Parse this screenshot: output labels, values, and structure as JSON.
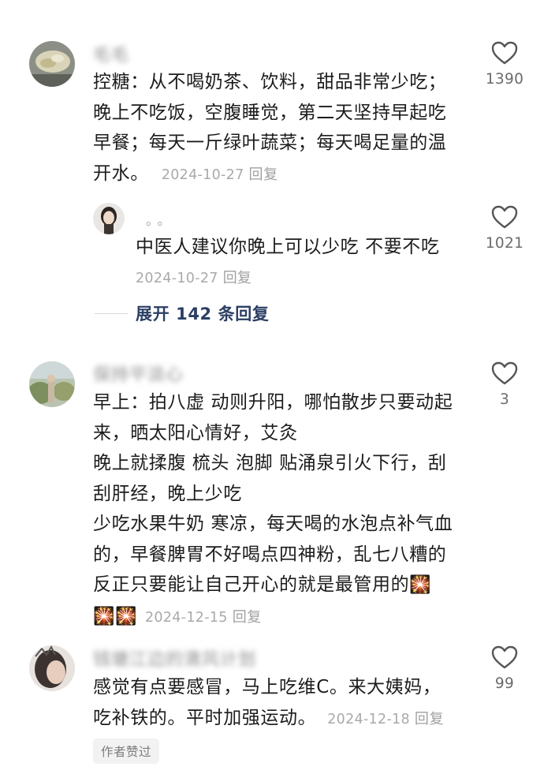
{
  "comments": [
    {
      "username": "毛毛",
      "lines": [
        "控糖：从不喝奶茶、饮料，甜品非常少吃；",
        "晚上不吃饭，空腹睡觉，第二天坚持早起吃",
        "早餐；每天一斤绿叶蔬菜；每天喝足量的温"
      ],
      "last_line": "开水。",
      "date": "2024-10-27",
      "reply": "回复",
      "likes": "1390"
    },
    {
      "username": "。。",
      "lines": [
        "中医人建议你晚上可以少吃 不要不吃"
      ],
      "date": "2024-10-27",
      "reply": "回复",
      "likes": "1021"
    },
    {
      "username": "保持平淡心",
      "lines": [
        "早上：拍八虚 动则升阳，哪怕散步只要动起",
        "来，晒太阳心情好，艾灸",
        "晚上就揉腹 梳头 泡脚 贴涌泉引火下行，刮",
        "刮肝经，晚上少吃",
        "少吃水果牛奶 寒凉，每天喝的水泡点补气血",
        "的，早餐脾胃不好喝点四神粉，乱七八糟的",
        "反正只要能让自己开心的就是最管用的"
      ],
      "emoji": "🎇🎇",
      "date": "2024-12-15",
      "reply": "回复",
      "likes": "3"
    },
    {
      "username": "钱塘江边的清风计划",
      "lines": [
        "感觉有点要感冒，马上吃维C。来大姨妈，"
      ],
      "last_line": "吃补铁的。平时加强运动。",
      "date": "2024-12-18",
      "reply": "回复",
      "likes": "99",
      "badge": "作者赞过"
    }
  ],
  "expand_replies": "展开 142 条回复",
  "colors": {
    "link_blue": "#2b3e63",
    "meta_gray": "#a9a9a9",
    "count_gray": "#6b6b6b"
  },
  "icons": {
    "like": "heart-outline-icon",
    "firework": "firework-emoji"
  }
}
